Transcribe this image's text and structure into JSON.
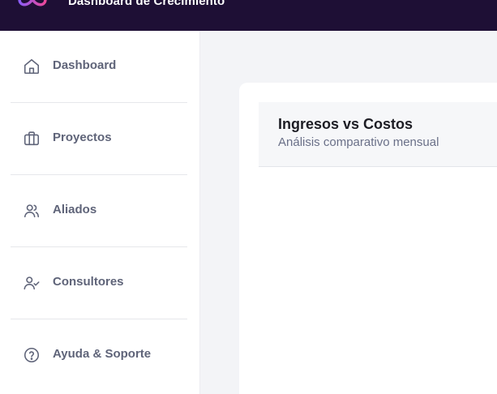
{
  "header": {
    "title": "Dashboard de Crecimiento",
    "logo_icon": "infinity-logo-icon"
  },
  "sidebar": {
    "items": [
      {
        "label": "Dashboard",
        "icon": "home-icon"
      },
      {
        "label": "Proyectos",
        "icon": "briefcase-icon"
      },
      {
        "label": "Aliados",
        "icon": "users-icon"
      },
      {
        "label": "Consultores",
        "icon": "user-check-icon"
      },
      {
        "label": "Ayuda & Soporte",
        "icon": "help-circle-icon"
      }
    ]
  },
  "main": {
    "chart_card": {
      "title": "Ingresos vs Costos",
      "subtitle": "Análisis comparativo mensual"
    }
  },
  "colors": {
    "topbar": "#1e0f35",
    "nav_text": "#5f6479",
    "page_background": "#f3f4f7",
    "logo_gradient_start": "#8b5cf6",
    "logo_gradient_end": "#ec4899"
  }
}
